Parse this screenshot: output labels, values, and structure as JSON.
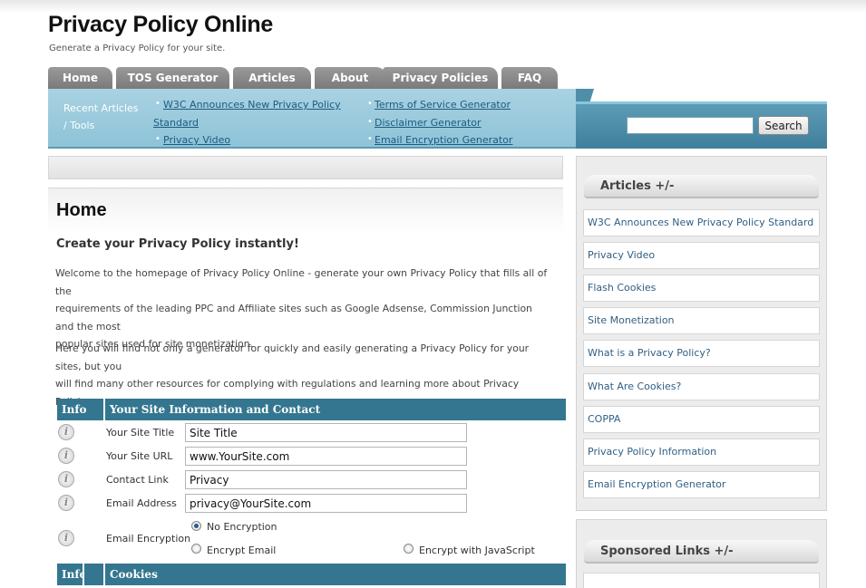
{
  "site": {
    "title": "Privacy Policy Online",
    "tagline": "Generate a Privacy Policy for your site."
  },
  "nav": {
    "tabs": [
      "Home",
      "TOS Generator",
      "Articles",
      "About",
      "Privacy Policies",
      "FAQ"
    ]
  },
  "banner": {
    "recent_label_line1": "Recent Articles",
    "recent_label_line2": "/ Tools",
    "links_left": [
      "W3C Announces New Privacy Policy",
      "Standard",
      "Privacy Video"
    ],
    "links_right": [
      "Terms of Service Generator",
      "Disclaimer Generator",
      "Email Encryption Generator"
    ],
    "bullet": "•"
  },
  "search": {
    "value": "",
    "button_label": "Search"
  },
  "main": {
    "page_title": "Home",
    "subheading": "Create your Privacy Policy instantly!",
    "paragraph1_line1": "Welcome to the homepage of Privacy Policy Online - generate your own Privacy Policy that fills all of the",
    "paragraph1_line2": "requirements of the leading PPC and Affiliate sites such as Google Adsense, Commission Junction and the most",
    "paragraph1_line3": "popular sites used for site monetization.",
    "paragraph2_line1": "Here you will find not only a generator for quickly and easily generating a Privacy Policy for your sites, but you",
    "paragraph2_line2": "will find many other resources for complying with regulations and learning more about Privacy Policies."
  },
  "form": {
    "header_info": "Info",
    "header_title": "Your Site Information and Contact",
    "info_glyph": "i",
    "rows": [
      {
        "label": "Your Site Title",
        "value": "Site Title"
      },
      {
        "label": "Your Site URL",
        "value": "www.YourSite.com"
      },
      {
        "label": "Contact Link",
        "value": "Privacy"
      },
      {
        "label": "Email Address",
        "value": "privacy@YourSite.com"
      }
    ],
    "encryption": {
      "label": "Email Encryption",
      "options": [
        "No Encryption",
        "Encrypt Email",
        "Encrypt with JavaScript"
      ],
      "selected": "No Encryption"
    },
    "cookies_header_info": "Info",
    "cookies_header_title": "Cookies"
  },
  "sidebar": {
    "articles_title": "Articles +/-",
    "articles": [
      "W3C Announces New Privacy Policy Standard",
      "Privacy Video",
      "Flash Cookies",
      "Site Monetization",
      "What is a Privacy Policy?",
      "What Are Cookies?",
      "COPPA",
      "Privacy Policy Information",
      "Email Encryption Generator"
    ],
    "sponsored_title": "Sponsored Links +/-"
  },
  "colors": {
    "nav_tab": "#8a8a8a",
    "banner": "#9ccbdd",
    "table_header": "#34768f",
    "link": "#2f5f84"
  }
}
